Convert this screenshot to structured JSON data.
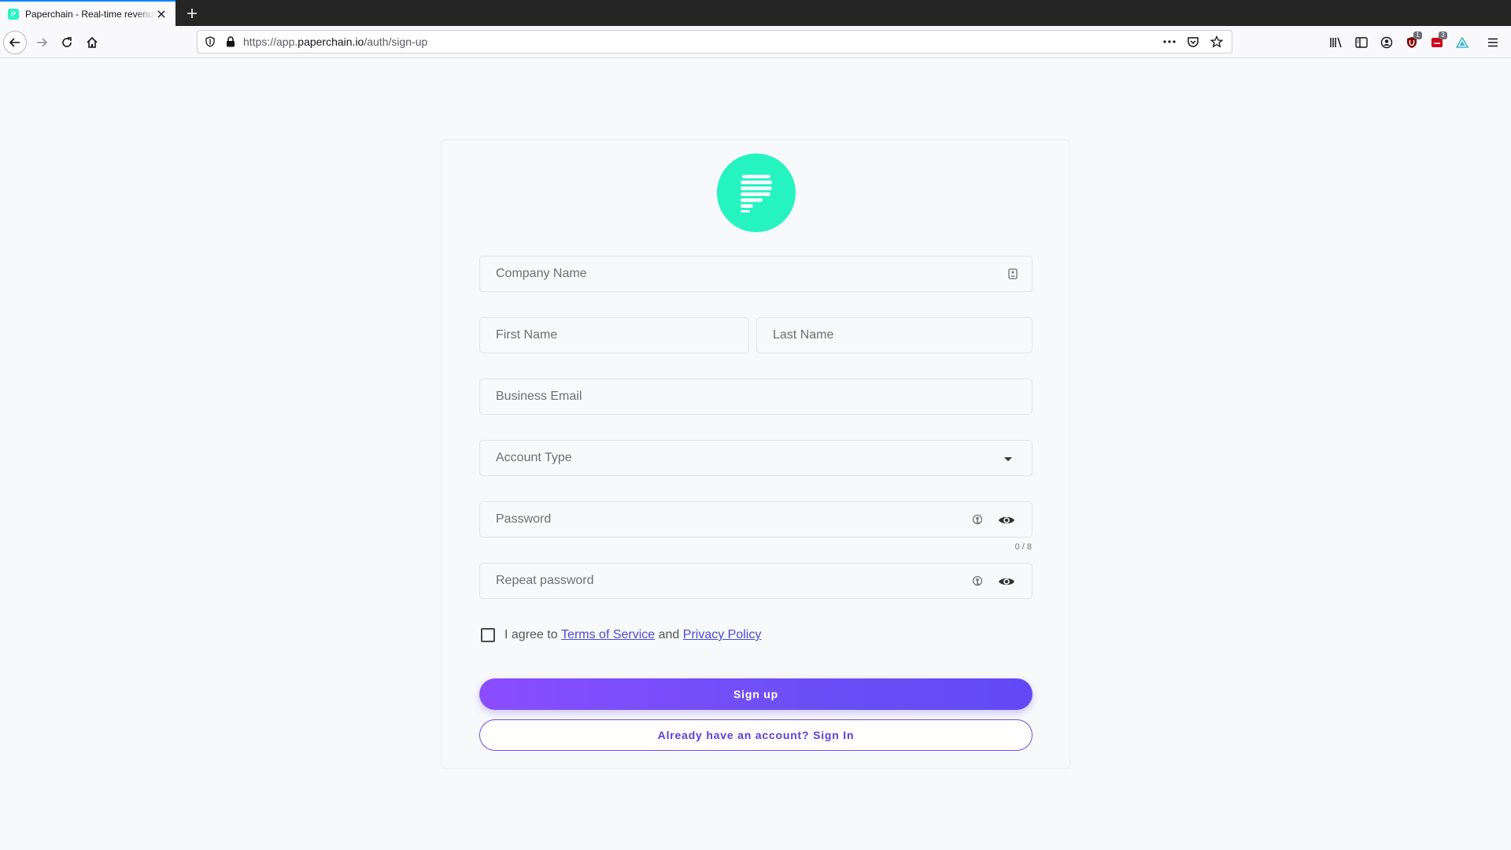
{
  "browser": {
    "tab_title": "Paperchain - Real-time revenue data",
    "favicon_letter": "P",
    "url_prefix": "https://app.",
    "url_domain": "paperchain.io",
    "url_path": "/auth/sign-up",
    "badges": {
      "ublock": "1",
      "extension": "3"
    }
  },
  "form": {
    "company_name": {
      "placeholder": "Company Name"
    },
    "first_name": {
      "placeholder": "First Name"
    },
    "last_name": {
      "placeholder": "Last Name"
    },
    "business_email": {
      "placeholder": "Business Email"
    },
    "account_type": {
      "label": "Account Type"
    },
    "password": {
      "placeholder": "Password",
      "counter": "0 / 8"
    },
    "repeat_password": {
      "placeholder": "Repeat password"
    },
    "agree": {
      "prefix": "I agree to ",
      "terms": "Terms of Service",
      "and": " and ",
      "privacy": "Privacy Policy"
    },
    "sign_up": "Sign up",
    "sign_in": "Already have an account? Sign In"
  },
  "colors": {
    "brand_teal": "#25f4c1",
    "primary_purple": "#6a4ff5",
    "link": "#4a4adb"
  }
}
